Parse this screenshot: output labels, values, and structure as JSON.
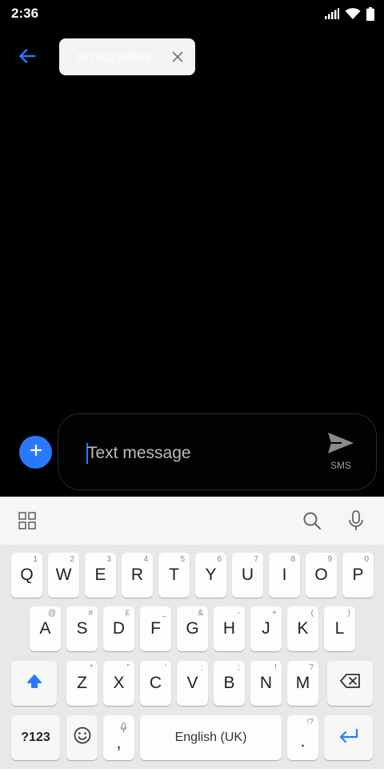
{
  "status_bar": {
    "time": "2:36",
    "icons": [
      "signal-icon",
      "wifi-icon",
      "battery-icon"
    ]
  },
  "header": {
    "back_icon": "back-arrow-icon",
    "recipient": "18730218809",
    "remove_icon": "close-icon"
  },
  "compose": {
    "attach_icon": "plus-icon",
    "placeholder": "Text message",
    "send_icon": "send-icon",
    "send_label": "SMS"
  },
  "keyboard": {
    "toolbar": [
      "apps-grid-icon",
      "search-icon",
      "mic-icon"
    ],
    "row1": [
      {
        "key": "Q",
        "hint": "1"
      },
      {
        "key": "W",
        "hint": "2"
      },
      {
        "key": "E",
        "hint": "3"
      },
      {
        "key": "R",
        "hint": "4"
      },
      {
        "key": "T",
        "hint": "5"
      },
      {
        "key": "Y",
        "hint": "6"
      },
      {
        "key": "U",
        "hint": "7"
      },
      {
        "key": "I",
        "hint": "8"
      },
      {
        "key": "O",
        "hint": "9"
      },
      {
        "key": "P",
        "hint": "0"
      }
    ],
    "row2": [
      {
        "key": "A",
        "hint": "@"
      },
      {
        "key": "S",
        "hint": "#"
      },
      {
        "key": "D",
        "hint": "£"
      },
      {
        "key": "F",
        "hint": "_"
      },
      {
        "key": "G",
        "hint": "&"
      },
      {
        "key": "H",
        "hint": "-"
      },
      {
        "key": "J",
        "hint": "+"
      },
      {
        "key": "K",
        "hint": "("
      },
      {
        "key": "L",
        "hint": ")"
      }
    ],
    "row3": [
      {
        "key": "Z",
        "hint": "*"
      },
      {
        "key": "X",
        "hint": "\""
      },
      {
        "key": "C",
        "hint": "'"
      },
      {
        "key": "V",
        "hint": ":"
      },
      {
        "key": "B",
        "hint": ";"
      },
      {
        "key": "N",
        "hint": "!"
      },
      {
        "key": "M",
        "hint": "?"
      }
    ],
    "symbols_label": "?123",
    "comma": ",",
    "space_label": "English (UK)",
    "period": ".",
    "period_hint": "!?",
    "accent_color": "#2979ff"
  }
}
